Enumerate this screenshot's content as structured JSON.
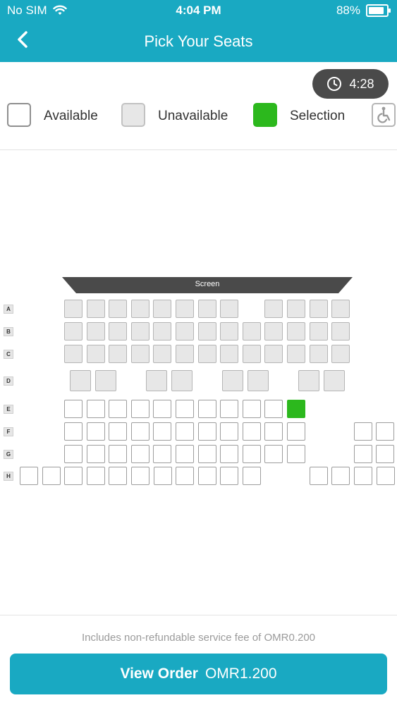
{
  "status_bar": {
    "carrier": "No SIM",
    "time": "4:04 PM",
    "battery": "88%",
    "battery_level": 0.88
  },
  "nav": {
    "title": "Pick Your Seats"
  },
  "timer": {
    "value": "4:28"
  },
  "legend": {
    "available": "Available",
    "unavailable": "Unavailable",
    "selection": "Selection"
  },
  "screen_label": "Screen",
  "rows": [
    {
      "label": "A",
      "seats": [
        "u",
        "u",
        "u",
        "u",
        "u",
        "u",
        "u",
        "u",
        "_",
        "u",
        "u",
        "u",
        "u"
      ]
    },
    {
      "label": "B",
      "seats": [
        "u",
        "u",
        "u",
        "u",
        "u",
        "u",
        "u",
        "u",
        "u",
        "u",
        "u",
        "u",
        "u"
      ]
    },
    {
      "label": "C",
      "seats": [
        "u",
        "u",
        "u",
        "u",
        "u",
        "u",
        "u",
        "u",
        "u",
        "u",
        "u",
        "u",
        "u"
      ]
    },
    {
      "label": "D",
      "seats": [
        "u",
        "u",
        "u",
        "u",
        "u",
        "u",
        "u",
        "u"
      ]
    },
    {
      "label": "E",
      "seats": [
        "a",
        "a",
        "a",
        "a",
        "a",
        "a",
        "a",
        "a",
        "a",
        "a",
        "s"
      ]
    },
    {
      "label": "F",
      "seats": [
        "a",
        "a",
        "a",
        "a",
        "a",
        "a",
        "a",
        "a",
        "a",
        "a",
        "a",
        "_",
        "_",
        "a",
        "a"
      ]
    },
    {
      "label": "G",
      "seats": [
        "a",
        "a",
        "a",
        "a",
        "a",
        "a",
        "a",
        "a",
        "a",
        "a",
        "a",
        "_",
        "_",
        "a",
        "a"
      ]
    },
    {
      "label": "H",
      "seats": [
        "a",
        "a",
        "a",
        "a",
        "a",
        "a",
        "a",
        "a",
        "a",
        "a",
        "a",
        "_",
        "_",
        "a",
        "a",
        "a",
        "a"
      ]
    }
  ],
  "footer": {
    "fee_note": "Includes non-refundable service fee of OMR0.200",
    "cta_label": "View Order",
    "cta_price": "OMR1.200"
  },
  "colors": {
    "brand": "#19a9c2",
    "selected": "#2cb81d",
    "timer_bg": "#4a4a4a"
  }
}
